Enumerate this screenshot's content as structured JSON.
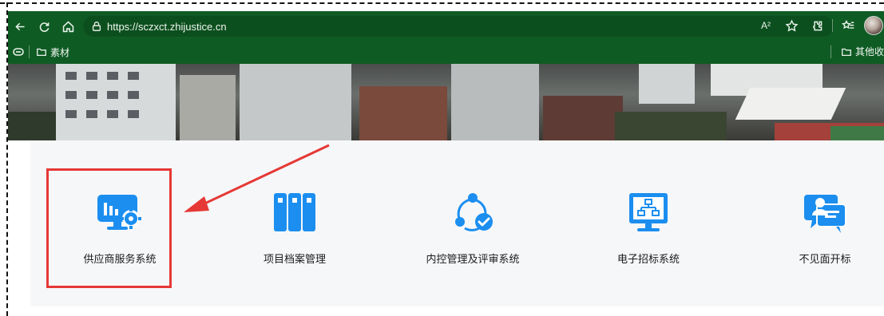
{
  "browser": {
    "url": "https://sczxct.zhijustice.cn",
    "read_aloud_label": "A²",
    "bookmarks": [
      {
        "label": "素材"
      }
    ],
    "other_bookmarks_label": "其他收"
  },
  "systems": [
    {
      "label": "供应商服务系统",
      "icon": "supplier-service-icon"
    },
    {
      "label": "项目档案管理",
      "icon": "archive-cabinet-icon"
    },
    {
      "label": "内控管理及评审系统",
      "icon": "internal-control-icon"
    },
    {
      "label": "电子招标系统",
      "icon": "e-tender-icon"
    },
    {
      "label": "不见面开标",
      "icon": "remote-bidding-icon"
    }
  ],
  "colors": {
    "chrome": "#0f5b24",
    "accent_blue": "#1b8ef0",
    "highlight": "#e53935"
  }
}
